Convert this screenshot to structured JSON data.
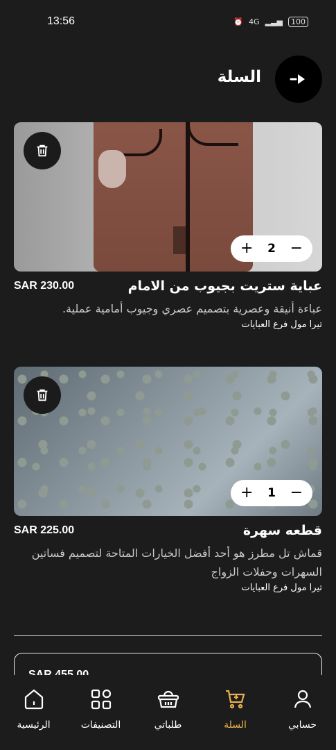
{
  "status_bar": {
    "time": "13:56",
    "signal": "4G",
    "battery": "100"
  },
  "header": {
    "title": "السلة"
  },
  "cart_items": [
    {
      "name": "عباية ستريت بجيوب من الامام",
      "price": "SAR 230.00",
      "description": "عباءة أنيقة وعصرية بتصميم عصري وجيوب أمامية عملية.",
      "store": "تيرا مول فرع العبايات",
      "quantity": "2"
    },
    {
      "name": "قطعه سهرة",
      "price": "SAR 225.00",
      "description": "قماش تل مطرز هو أحد أفضل الخيارات المتاحة لتصميم فساتين السهرات وحفلات الزواج",
      "store": "تيرا مول فرع العبايات",
      "quantity": "1"
    }
  ],
  "summary": {
    "total": "SAR 455.00"
  },
  "nav": {
    "account": "حسابي",
    "cart": "السلة",
    "orders": "طلباتي",
    "categories": "التصنيفات",
    "home": "الرئيسية"
  },
  "colors": {
    "accent": "#e7b24f",
    "background": "#1c1c1c"
  }
}
